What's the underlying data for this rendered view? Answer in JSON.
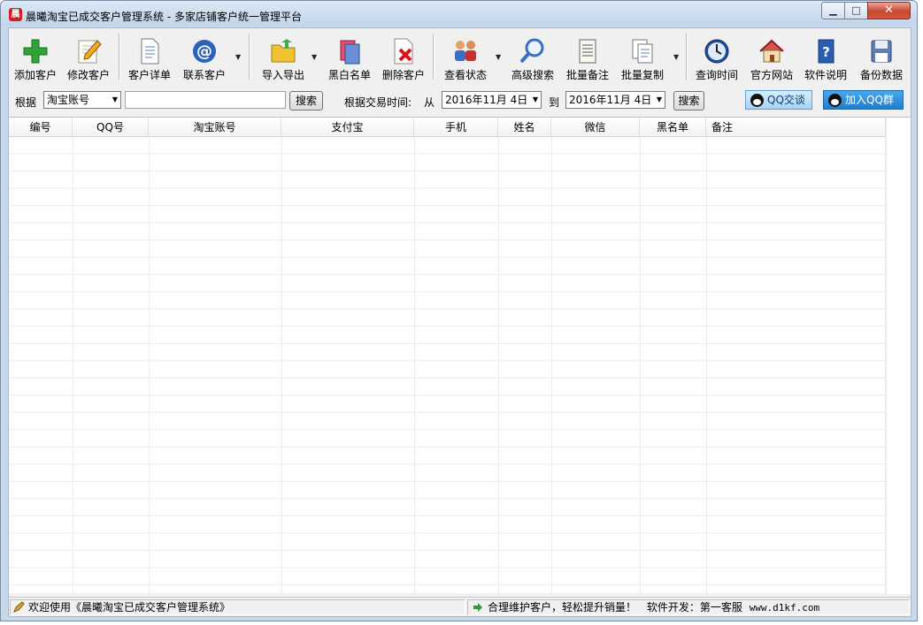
{
  "window": {
    "title": "晨曦淘宝已成交客户管理系统 - 多家店铺客户统一管理平台",
    "icon": "app-logo-icon",
    "controls": {
      "minimize": "▁",
      "maximize": "□",
      "close": "✕"
    }
  },
  "toolbar": {
    "items": [
      {
        "label": "添加客户",
        "icon": "plus-icon"
      },
      {
        "label": "修改客户",
        "icon": "edit-icon"
      },
      {
        "label": "客户详单",
        "icon": "document-icon"
      },
      {
        "label": "联系客户",
        "icon": "at-icon"
      },
      {
        "label": "导入导出",
        "icon": "folder-icon"
      },
      {
        "label": "黑白名单",
        "icon": "blacklist-icon"
      },
      {
        "label": "删除客户",
        "icon": "delete-icon"
      },
      {
        "label": "查看状态",
        "icon": "users-icon"
      },
      {
        "label": "高级搜索",
        "icon": "magnifier-icon"
      },
      {
        "label": "批量备注",
        "icon": "notes-icon"
      },
      {
        "label": "批量复制",
        "icon": "copy-icon"
      },
      {
        "label": "查询时间",
        "icon": "clock-icon"
      },
      {
        "label": "官方网站",
        "icon": "home-icon"
      },
      {
        "label": "软件说明",
        "icon": "help-book-icon"
      },
      {
        "label": "备份数据",
        "icon": "floppy-icon"
      }
    ]
  },
  "search": {
    "by_label": "根据",
    "field_selected": "淘宝账号",
    "keyword_value": "",
    "search_button": "搜索",
    "date_label": "根据交易时间:",
    "from_label": "从",
    "from_date": "2016年11月 4日",
    "to_label": "到",
    "to_date": "2016年11月 4日",
    "date_search_button": "搜索",
    "qq_chat": "QQ交谈",
    "qq_group": "加入QQ群"
  },
  "grid": {
    "columns": [
      "编号",
      "QQ号",
      "淘宝账号",
      "支付宝",
      "手机",
      "姓名",
      "微信",
      "黑名单",
      "备注"
    ],
    "rows": []
  },
  "status": {
    "welcome": "欢迎使用《晨曦淘宝已成交客户管理系统》",
    "slogan": "合理维护客户，轻松提升销量！",
    "developer_label": "软件开发：第一客服",
    "website": "www.d1kf.com"
  }
}
